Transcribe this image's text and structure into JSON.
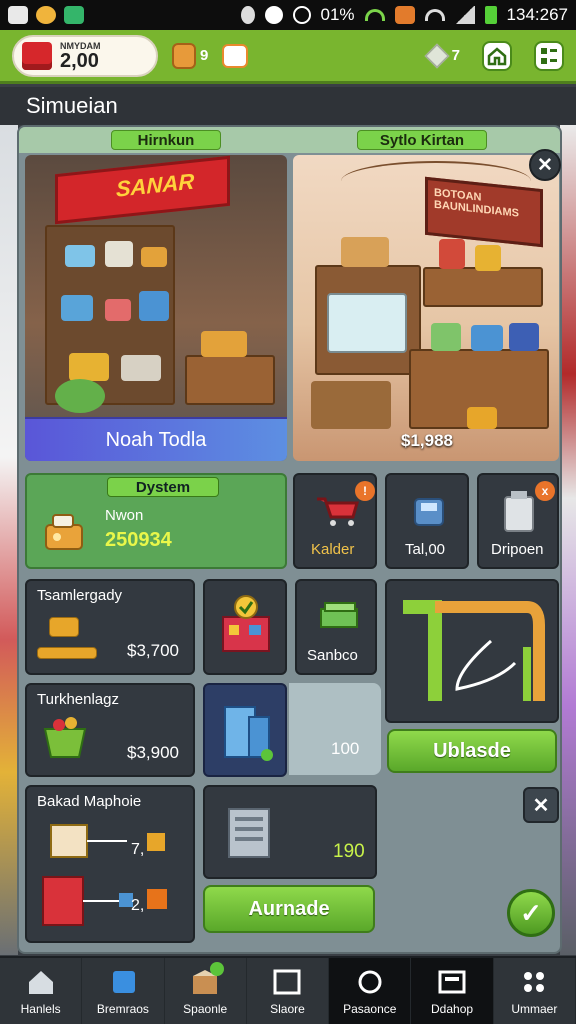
{
  "status_bar": {
    "battery": "01%",
    "time": "134:267"
  },
  "top_bar": {
    "coin_title": "NMYDAM",
    "coin_value": "2,00",
    "bag_count": "9",
    "cube_count": "7"
  },
  "screen_title": "Simueian",
  "panel": {
    "tab_left": "Hirnkun",
    "tab_right": "Sytlo Kirtan",
    "left_store": {
      "sign": "SANAR",
      "name": "Noah Todla"
    },
    "right_store": {
      "sign": "BOTOAN BAUNLINDIAMS",
      "price": "$1,988"
    }
  },
  "system_card": {
    "pill": "Dystem",
    "title": "Nwon",
    "value": "250934"
  },
  "small_cards": [
    {
      "label": "Kalder",
      "badge": ""
    },
    {
      "label": "Tal,00"
    },
    {
      "label": "Dripoen",
      "badge": "x"
    }
  ],
  "row2": {
    "card1": {
      "title": "Tsamlergady",
      "value": "$3,700"
    },
    "card2_label": "Sanbco"
  },
  "row3": {
    "card1": {
      "title": "Turkhenlagz",
      "value": "$3,900"
    },
    "ghost_value": "100",
    "unlock_button": "Ublasde"
  },
  "row4": {
    "card1": {
      "title": "Bakad Maphoie",
      "tag1": "7,",
      "tag2": "2,"
    },
    "card2_value": "190",
    "upgrade_button": "Aurnade"
  },
  "bottom_nav": [
    {
      "label": "Hanlels",
      "icon": "home-icon"
    },
    {
      "label": "Bremraos",
      "icon": "cube-icon"
    },
    {
      "label": "Spaonle",
      "icon": "shop-icon"
    },
    {
      "label": "Slaore",
      "icon": "frame-icon"
    },
    {
      "label": "Pasaonce",
      "icon": "search-icon"
    },
    {
      "label": "Ddahop",
      "icon": "board-icon"
    },
    {
      "label": "Ummaer",
      "icon": "grid-icon"
    }
  ]
}
